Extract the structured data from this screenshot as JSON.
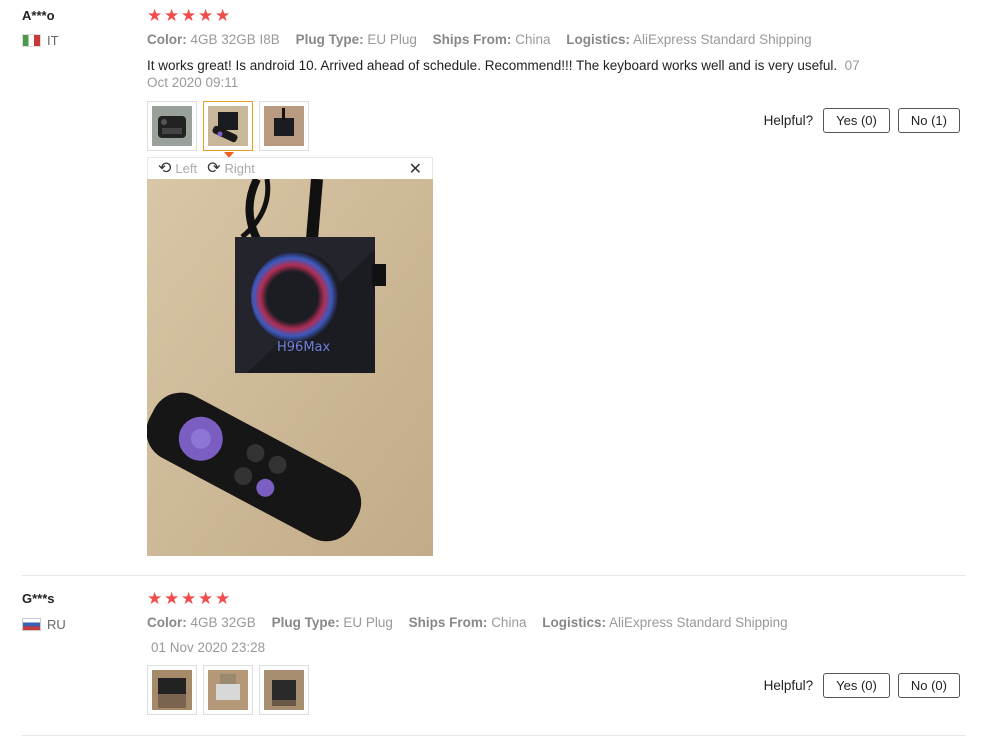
{
  "reviews": [
    {
      "user": "A***o",
      "country": "IT",
      "rating": 5,
      "attrs": [
        {
          "key": "Color:",
          "value": "4GB 32GB I8B"
        },
        {
          "key": "Plug Type:",
          "value": "EU Plug"
        },
        {
          "key": "Ships From:",
          "value": "China"
        },
        {
          "key": "Logistics:",
          "value": "AliExpress Standard Shipping"
        }
      ],
      "text": "It works great! Is android 10. Arrived ahead of schedule. Recommend!!! The keyboard works well and is very useful.",
      "date": "07 Oct 2020 09:11",
      "helpful_label": "Helpful?",
      "yes_label": "Yes (0)",
      "no_label": "No (1)"
    },
    {
      "user": "G***s",
      "country": "RU",
      "rating": 5,
      "attrs": [
        {
          "key": "Color:",
          "value": "4GB 32GB"
        },
        {
          "key": "Plug Type:",
          "value": "EU Plug"
        },
        {
          "key": "Ships From:",
          "value": "China"
        },
        {
          "key": "Logistics:",
          "value": "AliExpress Standard Shipping"
        }
      ],
      "date": "01 Nov 2020 23:28",
      "helpful_label": "Helpful?",
      "yes_label": "Yes (0)",
      "no_label": "No (0)"
    }
  ],
  "viewer": {
    "rotate_left_label": "Left",
    "rotate_right_label": "Right",
    "close_icon": "close-icon"
  }
}
